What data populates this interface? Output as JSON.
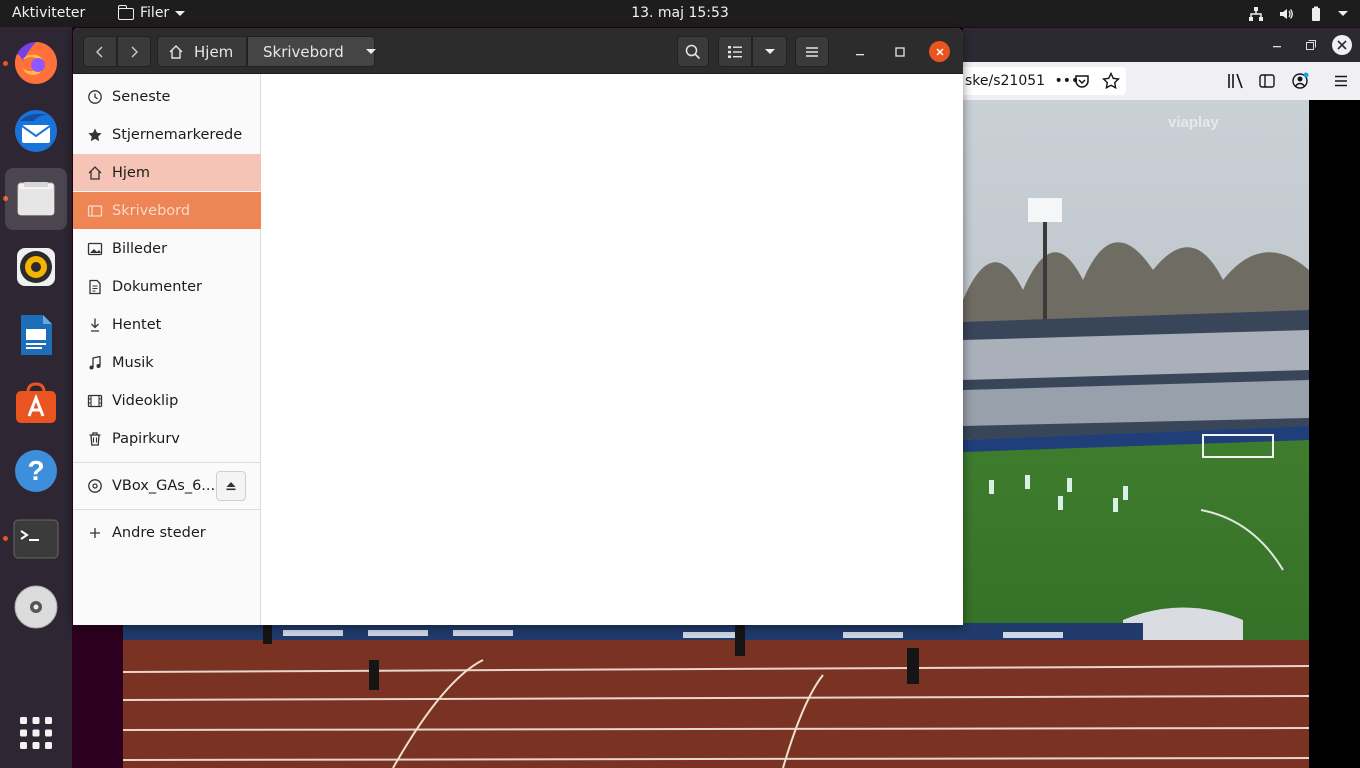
{
  "topbar": {
    "activities": "Aktiviteter",
    "app_menu": "Filer",
    "clock": "13. maj  15:53"
  },
  "browser": {
    "url_fragment": "ske/s21051",
    "url_more": "•••",
    "watermark": "viaplay"
  },
  "file_manager": {
    "path": {
      "home": "Hjem",
      "current": "Skrivebord"
    },
    "sidebar": {
      "items": [
        {
          "label": "Seneste",
          "icon": "clock-icon"
        },
        {
          "label": "Stjernemarkerede",
          "icon": "star-icon"
        },
        {
          "label": "Hjem",
          "icon": "home-icon"
        },
        {
          "label": "Skrivebord",
          "icon": "desktop-icon"
        },
        {
          "label": "Billeder",
          "icon": "image-icon"
        },
        {
          "label": "Dokumenter",
          "icon": "document-icon"
        },
        {
          "label": "Hentet",
          "icon": "download-icon"
        },
        {
          "label": "Musik",
          "icon": "music-icon"
        },
        {
          "label": "Videoklip",
          "icon": "video-icon"
        },
        {
          "label": "Papirkurv",
          "icon": "trash-icon"
        }
      ],
      "device": {
        "label": "VBox_GAs_6....",
        "icon": "disc-icon"
      },
      "other": {
        "label": "Andre steder",
        "icon": "plus-icon"
      }
    }
  },
  "colors": {
    "accent": "#e95420",
    "selected": "#ed8555",
    "hover": "#f5c4b6",
    "header": "#2c2c2c",
    "topbar": "#1d1d1d"
  }
}
